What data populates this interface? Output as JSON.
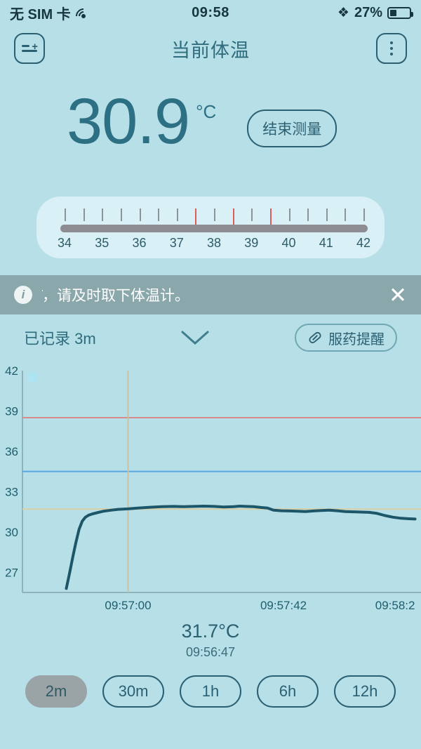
{
  "status_bar": {
    "carrier": "无 SIM 卡",
    "wifi_icon": "wifi-icon",
    "time": "09:58",
    "bluetooth_icon": "bluetooth-icon",
    "battery_percent": "27%",
    "battery_icon": "battery-icon"
  },
  "app_bar": {
    "left_icon": "add-record-icon",
    "title": "当前体温",
    "right_icon": "overflow-menu-icon"
  },
  "reading": {
    "value": "30.9",
    "unit": "°C",
    "stop_button": "结束测量"
  },
  "scale": {
    "min": 34,
    "max": 42,
    "labels": [
      "34",
      "35",
      "36",
      "37",
      "38",
      "39",
      "40",
      "41",
      "42"
    ],
    "tick_values": [
      34,
      34.5,
      35,
      35.5,
      36,
      36.5,
      37,
      37.5,
      38,
      38.5,
      39,
      39.5,
      40,
      40.5,
      41,
      41.5,
      42
    ],
    "warning_ticks": [
      37.5,
      38.5,
      39.5
    ],
    "bar_color": "#8c8c92",
    "tick_color": "#8a9499",
    "warning_color": "#e05c5c",
    "card_bg": "#d9f1f6"
  },
  "notice": {
    "icon": "info-icon",
    "text": "̇，请及时取下体温计。",
    "close_icon": "close-icon",
    "bg": "#8aa8ab"
  },
  "record_row": {
    "label": "已记录 3m",
    "chevron_icon": "chevron-down-icon",
    "med_button": "服药提醒",
    "med_icon": "pill-icon"
  },
  "chart_data": {
    "type": "line",
    "title": "",
    "xlabel": "",
    "ylabel": "",
    "ylim": [
      25.5,
      42
    ],
    "yticks": [
      27,
      30,
      33,
      36,
      39,
      42
    ],
    "xticks": [
      "09:57:00",
      "09:57:42",
      "09:58:2"
    ],
    "xtick_positions": [
      0.265,
      0.655,
      0.985
    ],
    "grid": false,
    "line_color": "#1d5668",
    "reference_lines": [
      {
        "name": "high-fever-line",
        "value": 38.5,
        "color": "#d98b8b"
      },
      {
        "name": "mid-line",
        "value": 34.5,
        "color": "#5aa7e0"
      },
      {
        "name": "current-line",
        "value": 31.7,
        "color": "#d8cfa8"
      }
    ],
    "cursor_x_fraction": 0.265,
    "cursor_color": "#c9c2a4",
    "series": [
      {
        "name": "体温",
        "x": [
          0.11,
          0.118,
          0.126,
          0.134,
          0.142,
          0.15,
          0.158,
          0.166,
          0.176,
          0.19,
          0.205,
          0.222,
          0.24,
          0.265,
          0.29,
          0.32,
          0.35,
          0.38,
          0.405,
          0.43,
          0.455,
          0.48,
          0.505,
          0.53,
          0.545,
          0.56,
          0.58,
          0.6,
          0.615,
          0.63,
          0.65,
          0.67,
          0.69,
          0.71,
          0.73,
          0.75,
          0.77,
          0.79,
          0.81,
          0.83,
          0.85,
          0.87,
          0.89,
          0.91,
          0.93,
          0.95,
          0.97,
          0.985
        ],
        "y": [
          25.8,
          26.9,
          28.1,
          29.2,
          30.2,
          30.8,
          31.1,
          31.25,
          31.35,
          31.45,
          31.55,
          31.62,
          31.68,
          31.72,
          31.78,
          31.84,
          31.88,
          31.9,
          31.88,
          31.9,
          31.92,
          31.9,
          31.86,
          31.88,
          31.92,
          31.9,
          31.88,
          31.82,
          31.78,
          31.62,
          31.58,
          31.56,
          31.54,
          31.52,
          31.56,
          31.6,
          31.62,
          31.58,
          31.52,
          31.5,
          31.48,
          31.46,
          31.38,
          31.22,
          31.1,
          31.02,
          30.98,
          30.96
        ]
      }
    ],
    "marker": {
      "name": "chart-marker",
      "color": "#aee4f2"
    }
  },
  "readout": {
    "temperature": "31.7°C",
    "time": "09:56:47"
  },
  "ranges": {
    "selected": "2m",
    "items": [
      "2m",
      "30m",
      "1h",
      "6h",
      "12h"
    ]
  },
  "theme": {
    "bg": "#b6dfe8",
    "primary_text": "#2b6072",
    "accent": "#2d7083"
  }
}
